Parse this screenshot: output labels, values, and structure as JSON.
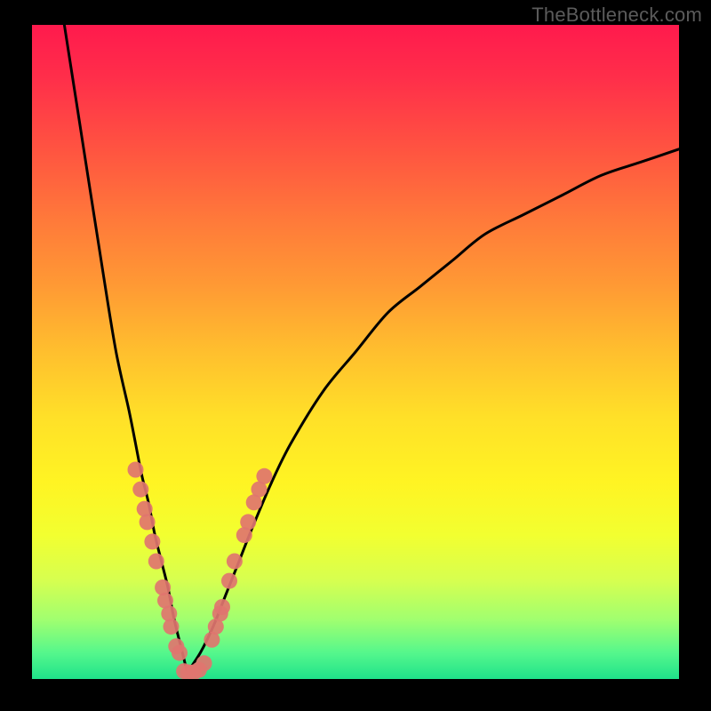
{
  "watermark": "TheBottleneck.com",
  "colors": {
    "gradient_top": "#ff1a4d",
    "gradient_bottom": "#1fe28a",
    "curve": "#000000",
    "dots": "#e0756f",
    "frame": "#000000"
  },
  "chart_data": {
    "type": "line",
    "title": "",
    "xlabel": "",
    "ylabel": "",
    "xlim": [
      0,
      100
    ],
    "ylim": [
      0,
      100
    ],
    "grid": false,
    "legend": false,
    "note": "V-shaped bottleneck curve; minimum near x≈24",
    "series": [
      {
        "name": "left-branch",
        "x": [
          5,
          8,
          11,
          13,
          15,
          16,
          17,
          18,
          19,
          20,
          21,
          22,
          23,
          24
        ],
        "y": [
          100,
          81,
          62,
          50,
          41,
          36,
          31,
          27,
          22,
          18,
          14,
          9,
          5,
          1
        ]
      },
      {
        "name": "right-branch",
        "x": [
          24,
          26,
          28,
          30,
          32,
          34,
          37,
          40,
          45,
          50,
          55,
          60,
          65,
          70,
          76,
          82,
          88,
          94,
          100
        ],
        "y": [
          1,
          4,
          8,
          13,
          18,
          23,
          30,
          36,
          44,
          50,
          56,
          60,
          64,
          68,
          71,
          74,
          77,
          79,
          81
        ]
      }
    ],
    "markers": [
      {
        "series": "left-cluster",
        "x": 16.0,
        "y": 32
      },
      {
        "series": "left-cluster",
        "x": 16.8,
        "y": 29
      },
      {
        "series": "left-cluster",
        "x": 17.4,
        "y": 26
      },
      {
        "series": "left-cluster",
        "x": 17.8,
        "y": 24
      },
      {
        "series": "left-cluster",
        "x": 18.6,
        "y": 21
      },
      {
        "series": "left-cluster",
        "x": 19.2,
        "y": 18
      },
      {
        "series": "left-cluster",
        "x": 20.2,
        "y": 14
      },
      {
        "series": "left-cluster",
        "x": 20.6,
        "y": 12
      },
      {
        "series": "left-cluster",
        "x": 21.2,
        "y": 10
      },
      {
        "series": "left-cluster",
        "x": 21.5,
        "y": 8
      },
      {
        "series": "left-cluster",
        "x": 22.3,
        "y": 5
      },
      {
        "series": "left-cluster",
        "x": 22.8,
        "y": 4
      },
      {
        "series": "bottom",
        "x": 23.5,
        "y": 1.2
      },
      {
        "series": "bottom",
        "x": 24.2,
        "y": 1.0
      },
      {
        "series": "bottom",
        "x": 25.0,
        "y": 1.0
      },
      {
        "series": "bottom",
        "x": 25.8,
        "y": 1.4
      },
      {
        "series": "bottom",
        "x": 26.6,
        "y": 2.4
      },
      {
        "series": "right-cluster",
        "x": 27.8,
        "y": 6
      },
      {
        "series": "right-cluster",
        "x": 28.4,
        "y": 8
      },
      {
        "series": "right-cluster",
        "x": 29.1,
        "y": 10
      },
      {
        "series": "right-cluster",
        "x": 29.4,
        "y": 11
      },
      {
        "series": "right-cluster",
        "x": 30.5,
        "y": 15
      },
      {
        "series": "right-cluster",
        "x": 31.3,
        "y": 18
      },
      {
        "series": "right-cluster",
        "x": 32.8,
        "y": 22
      },
      {
        "series": "right-cluster",
        "x": 33.4,
        "y": 24
      },
      {
        "series": "right-cluster",
        "x": 34.3,
        "y": 27
      },
      {
        "series": "right-cluster",
        "x": 35.1,
        "y": 29
      },
      {
        "series": "right-cluster",
        "x": 35.9,
        "y": 31
      }
    ]
  }
}
